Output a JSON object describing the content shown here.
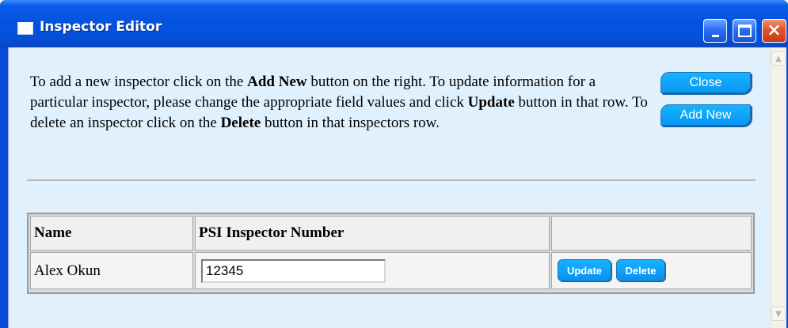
{
  "window": {
    "title": "Inspector Editor",
    "minimize_icon": "minimize-icon",
    "maximize_icon": "maximize-icon",
    "close_icon": "close-x-icon"
  },
  "instructions": {
    "part1": "To add a new inspector click on the ",
    "add_new_bold": "Add New",
    "part2": " button on the right. To update information for a particular inspector, please change the appropriate field values and click ",
    "update_bold": "Update",
    "part3": " button in that row. To delete an inspector click on the ",
    "delete_bold": "Delete",
    "part4": " button in that inspectors row."
  },
  "buttons": {
    "close_label": "Close",
    "add_new_label": "Add New"
  },
  "table": {
    "headers": [
      "Name",
      "PSI Inspector Number",
      ""
    ],
    "rows": [
      {
        "name": "Alex Okun",
        "inspector_number": "12345",
        "update_label": "Update",
        "delete_label": "Delete"
      }
    ]
  },
  "colors": {
    "titlebar": "#0453e0",
    "client_background": "#e0f0fc",
    "button_blue": "#0897f3",
    "close_red": "#e0522b"
  }
}
